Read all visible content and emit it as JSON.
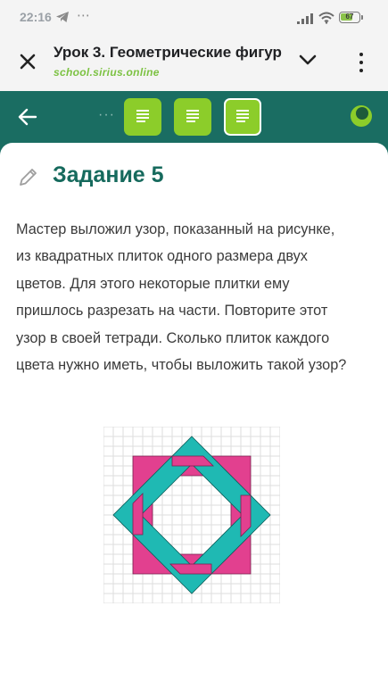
{
  "status_bar": {
    "time": "22:16",
    "battery_level": "67",
    "icons": [
      "telegram-icon",
      "more-dots-icon",
      "signal-icon",
      "wifi-icon",
      "battery-icon"
    ]
  },
  "browser": {
    "title": "Урок 3. Геометрические фигур",
    "url": "school.sirius.online",
    "icons": [
      "close-icon",
      "chevron-down-icon",
      "more-vert-icon"
    ]
  },
  "toolbar": {
    "more_indicator": "···",
    "tasks": [
      {
        "icon": "document-icon",
        "state": "done"
      },
      {
        "icon": "document-icon",
        "state": "done"
      },
      {
        "icon": "document-icon",
        "state": "current"
      }
    ],
    "colors": {
      "bar": "#1a6d62",
      "tile": "#8ccd2a",
      "title": "#166a5d"
    }
  },
  "task": {
    "heading": "Задание 5",
    "text_lines": [
      "Мастер выложил узор, показанный на рисунке,",
      "из квадратных плиток одного размера двух",
      "цветов. Для этого некоторые плитки ему",
      "пришлось разрезать на части. Повторите этот",
      "узор в своей тетради. Сколько плиток каждого",
      "цвета нужно иметь, чтобы выложить такой узор?"
    ]
  },
  "figure": {
    "colors": {
      "pink": "#e2408f",
      "teal": "#1fb9b3",
      "grid": "#dddddd"
    }
  }
}
